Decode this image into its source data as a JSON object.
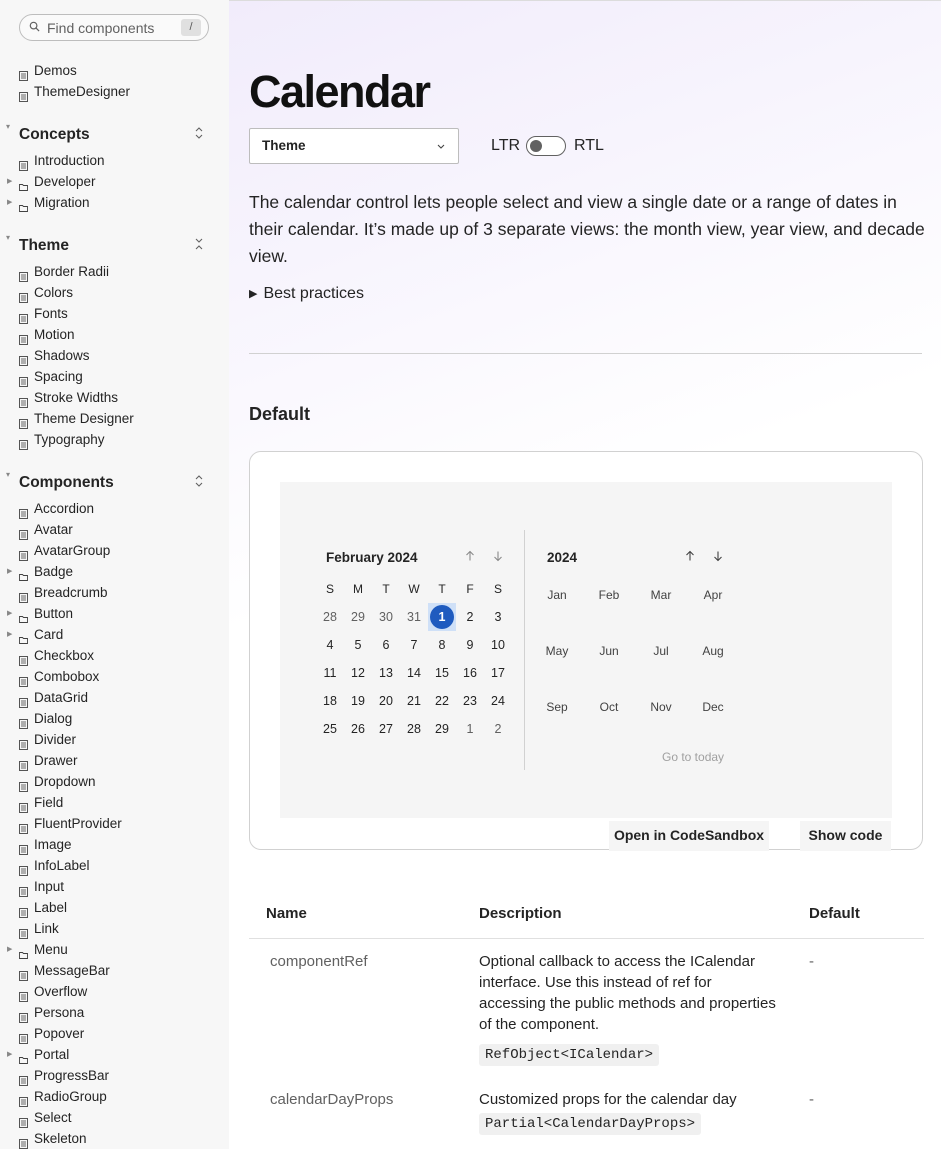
{
  "search": {
    "placeholder": "Find components",
    "shortcut": "/"
  },
  "sidebar": {
    "top_items": [
      "Demos",
      "ThemeDesigner"
    ],
    "sections": [
      {
        "title": "Concepts",
        "toggle": "expand-collapse",
        "items": [
          {
            "label": "Introduction",
            "type": "page"
          },
          {
            "label": "Developer",
            "type": "folder"
          },
          {
            "label": "Migration",
            "type": "folder"
          }
        ]
      },
      {
        "title": "Theme",
        "toggle": "collapse",
        "items": [
          {
            "label": "Border Radii",
            "type": "page"
          },
          {
            "label": "Colors",
            "type": "page"
          },
          {
            "label": "Fonts",
            "type": "page"
          },
          {
            "label": "Motion",
            "type": "page"
          },
          {
            "label": "Shadows",
            "type": "page"
          },
          {
            "label": "Spacing",
            "type": "page"
          },
          {
            "label": "Stroke Widths",
            "type": "page"
          },
          {
            "label": "Theme Designer",
            "type": "page"
          },
          {
            "label": "Typography",
            "type": "page"
          }
        ]
      },
      {
        "title": "Components",
        "toggle": "expand-collapse",
        "items": [
          {
            "label": "Accordion",
            "type": "page"
          },
          {
            "label": "Avatar",
            "type": "page"
          },
          {
            "label": "AvatarGroup",
            "type": "page"
          },
          {
            "label": "Badge",
            "type": "folder"
          },
          {
            "label": "Breadcrumb",
            "type": "page"
          },
          {
            "label": "Button",
            "type": "folder"
          },
          {
            "label": "Card",
            "type": "folder"
          },
          {
            "label": "Checkbox",
            "type": "page"
          },
          {
            "label": "Combobox",
            "type": "page"
          },
          {
            "label": "DataGrid",
            "type": "page"
          },
          {
            "label": "Dialog",
            "type": "page"
          },
          {
            "label": "Divider",
            "type": "page"
          },
          {
            "label": "Drawer",
            "type": "page"
          },
          {
            "label": "Dropdown",
            "type": "page"
          },
          {
            "label": "Field",
            "type": "page"
          },
          {
            "label": "FluentProvider",
            "type": "page"
          },
          {
            "label": "Image",
            "type": "page"
          },
          {
            "label": "InfoLabel",
            "type": "page"
          },
          {
            "label": "Input",
            "type": "page"
          },
          {
            "label": "Label",
            "type": "page"
          },
          {
            "label": "Link",
            "type": "page"
          },
          {
            "label": "Menu",
            "type": "folder"
          },
          {
            "label": "MessageBar",
            "type": "page"
          },
          {
            "label": "Overflow",
            "type": "page"
          },
          {
            "label": "Persona",
            "type": "page"
          },
          {
            "label": "Popover",
            "type": "page"
          },
          {
            "label": "Portal",
            "type": "folder"
          },
          {
            "label": "ProgressBar",
            "type": "page"
          },
          {
            "label": "RadioGroup",
            "type": "page"
          },
          {
            "label": "Select",
            "type": "page"
          },
          {
            "label": "Skeleton",
            "type": "page"
          }
        ]
      }
    ]
  },
  "main": {
    "title": "Calendar",
    "theme_select": "Theme",
    "dir_ltr": "LTR",
    "dir_rtl": "RTL",
    "description": "The calendar control lets people select and view a single date or a range of dates in their calendar. It’s made up of 3 separate views: the month view, year view, and decade view.",
    "best_practices": "Best practices",
    "section_title": "Default",
    "open_sandbox": "Open in CodeSandbox",
    "show_code": "Show code"
  },
  "calendar": {
    "month_title": "February 2024",
    "weekdays": [
      "S",
      "M",
      "T",
      "W",
      "T",
      "F",
      "S"
    ],
    "weeks": [
      [
        "28",
        "29",
        "30",
        "31",
        "1",
        "2",
        "3"
      ],
      [
        "4",
        "5",
        "6",
        "7",
        "8",
        "9",
        "10"
      ],
      [
        "11",
        "12",
        "13",
        "14",
        "15",
        "16",
        "17"
      ],
      [
        "18",
        "19",
        "20",
        "21",
        "22",
        "23",
        "24"
      ],
      [
        "25",
        "26",
        "27",
        "28",
        "29",
        "1",
        "2"
      ]
    ],
    "selected_day": "1",
    "year_title": "2024",
    "months": [
      "Jan",
      "Feb",
      "Mar",
      "Apr",
      "May",
      "Jun",
      "Jul",
      "Aug",
      "Sep",
      "Oct",
      "Nov",
      "Dec"
    ],
    "go_to_today": "Go to today",
    "accent_color": "#1f5bbf"
  },
  "props_table": {
    "headers": [
      "Name",
      "Description",
      "Default"
    ],
    "rows": [
      {
        "name": "componentRef",
        "description": "Optional callback to access the ICalendar interface. Use this instead of ref for accessing the public methods and properties of the component.",
        "type": "RefObject<ICalendar>",
        "default": "-"
      },
      {
        "name": "calendarDayProps",
        "description": "Customized props for the calendar day",
        "type": "Partial<CalendarDayProps>",
        "default": "-"
      }
    ]
  }
}
